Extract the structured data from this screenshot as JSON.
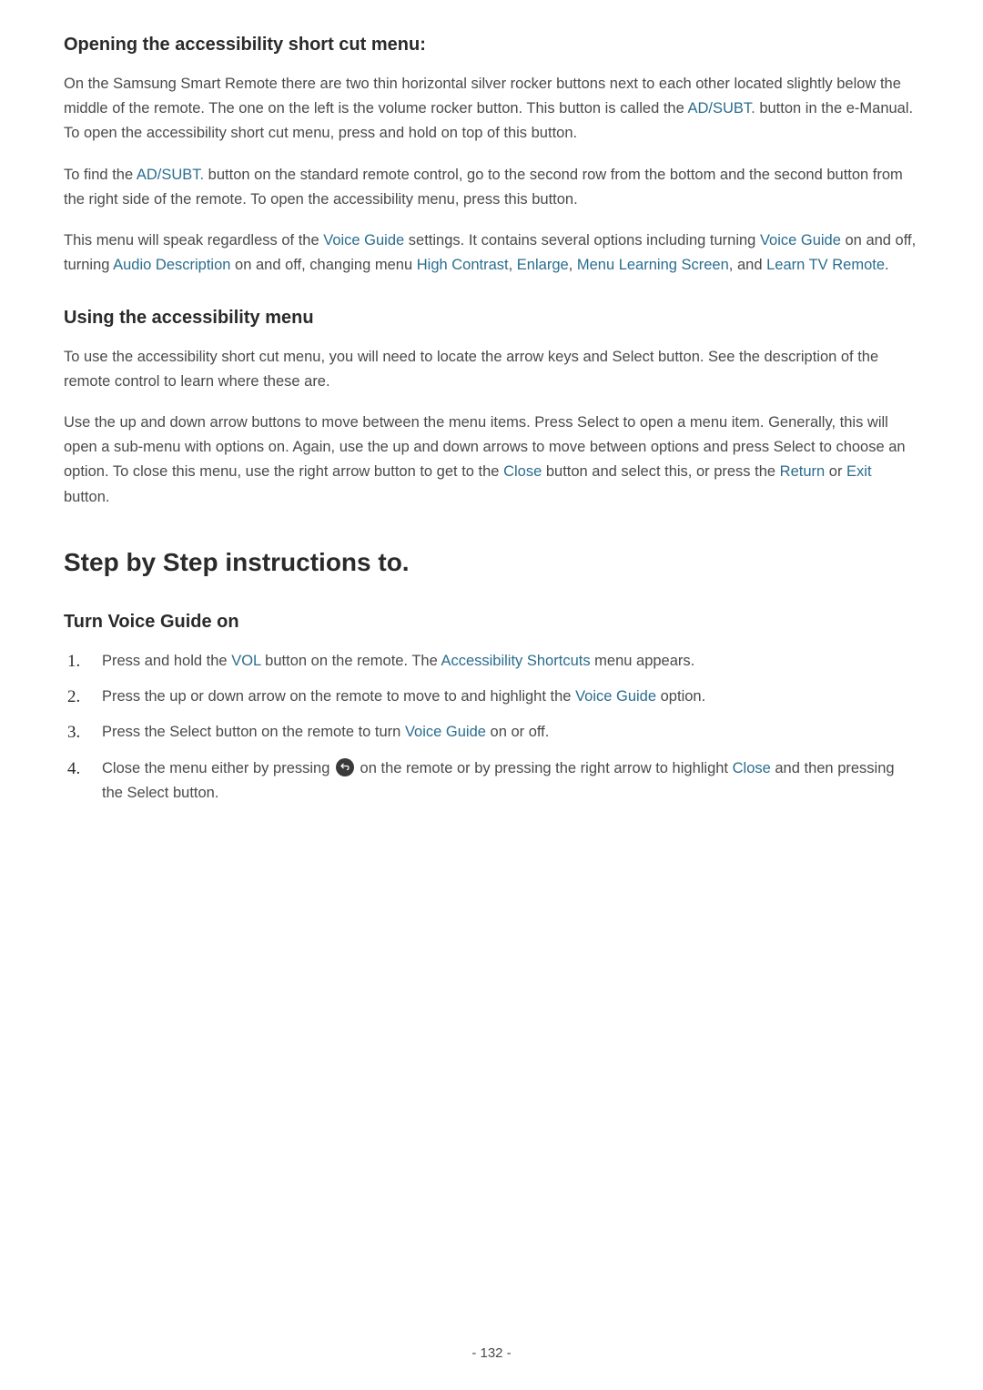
{
  "section1": {
    "heading": "Opening the accessibility short cut menu:",
    "p1_a": "On the Samsung Smart Remote there are two thin horizontal silver rocker buttons next to each other located slightly below the middle of the remote. The one on the left is the volume rocker button. This button is called the ",
    "p1_term1": "AD/SUBT.",
    "p1_b": " button in the e-Manual. To open the accessibility short cut menu, press and hold on top of this button.",
    "p2_a": "To find the ",
    "p2_term1": "AD/SUBT.",
    "p2_b": " button on the standard remote control, go to the second row from the bottom and the second button from the right side of the remote. To open the accessibility menu, press this button.",
    "p3_a": "This menu will speak regardless of the ",
    "p3_term1": "Voice Guide",
    "p3_b": " settings. It contains several options including turning ",
    "p3_term2": "Voice Guide",
    "p3_c": " on and off, turning ",
    "p3_term3": "Audio Description",
    "p3_d": " on and off, changing menu ",
    "p3_term4": "High Contrast",
    "p3_e": ", ",
    "p3_term5": "Enlarge",
    "p3_f": ", ",
    "p3_term6": "Menu Learning Screen",
    "p3_g": ", and ",
    "p3_term7": "Learn TV Remote",
    "p3_h": "."
  },
  "section2": {
    "heading": "Using the accessibility menu",
    "p1": "To use the accessibility short cut menu, you will need to locate the arrow keys and Select button. See the description of the remote control to learn where these are.",
    "p2_a": "Use the up and down arrow buttons to move between the menu items. Press Select to open a menu item. Generally, this will open a sub-menu with options on. Again, use the up and down arrows to move between options and press Select to choose an option. To close this menu, use the right arrow button to get to the ",
    "p2_term1": "Close",
    "p2_b": " button and select this, or press the ",
    "p2_term2": "Return",
    "p2_c": " or ",
    "p2_term3": "Exit",
    "p2_d": " button."
  },
  "section3": {
    "heading": "Step by Step instructions to.",
    "sub_heading": "Turn Voice Guide on",
    "li1_a": "Press and hold the ",
    "li1_term1": "VOL",
    "li1_b": " button on the remote. The ",
    "li1_term2": "Accessibility Shortcuts",
    "li1_c": " menu appears.",
    "li2_a": "Press the up or down arrow on the remote to move to and highlight the ",
    "li2_term1": "Voice Guide",
    "li2_b": " option.",
    "li3_a": "Press the Select button on the remote to turn ",
    "li3_term1": "Voice Guide",
    "li3_b": " on or off.",
    "li4_a": "Close the menu either by pressing ",
    "li4_b": " on the remote or by pressing the right arrow to highlight ",
    "li4_term1": "Close",
    "li4_c": " and then pressing the Select button."
  },
  "page_number": "- 132 -"
}
